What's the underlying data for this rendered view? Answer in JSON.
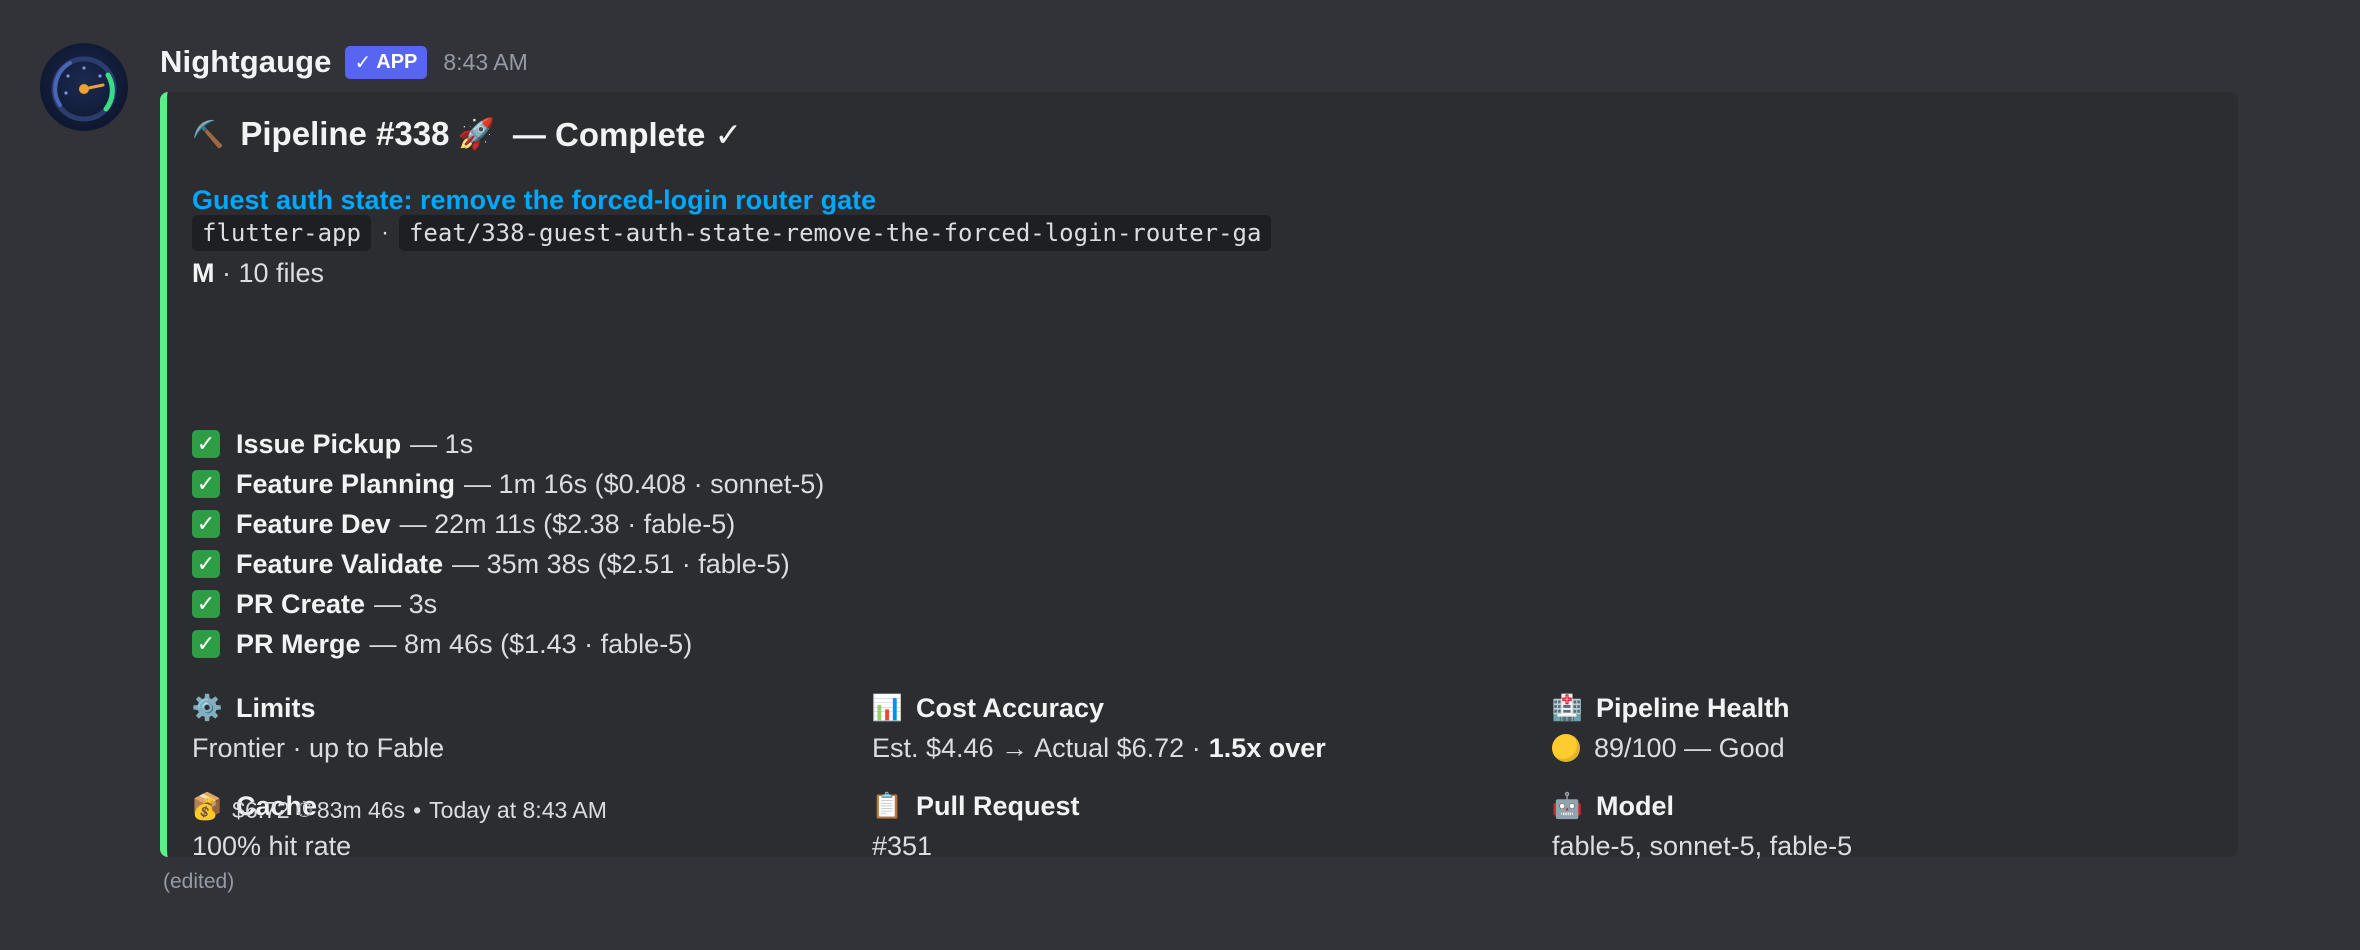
{
  "message": {
    "username": "Nightgauge",
    "badge_check": "✓",
    "badge_label": "APP",
    "timestamp": "8:43 AM",
    "avatar_icon": "speedometer-icon",
    "edited_label": "(edited)"
  },
  "embed": {
    "accent_color": "#57f287",
    "title_icon": "⛏️",
    "title_text": "Pipeline #338",
    "title_rocket": "🚀",
    "title_suffix": "— Complete ✓",
    "issue_link": "Guest auth state: remove the forced-login router gate",
    "repo": "flutter-app",
    "separator": "·",
    "branch": "feat/338-guest-auth-state-remove-the-forced-login-router-ga",
    "size_label": "M",
    "size_files": "· 10 files",
    "stages": [
      {
        "status_icon": "✓",
        "name": "Issue Pickup",
        "detail": "— 1s"
      },
      {
        "status_icon": "✓",
        "name": "Feature Planning",
        "detail": "— 1m 16s ($0.408 · sonnet-5)"
      },
      {
        "status_icon": "✓",
        "name": "Feature Dev",
        "detail": "— 22m 11s ($2.38 · fable-5)"
      },
      {
        "status_icon": "✓",
        "name": "Feature Validate",
        "detail": "— 35m 38s ($2.51 · fable-5)"
      },
      {
        "status_icon": "✓",
        "name": "PR Create",
        "detail": "— 3s"
      },
      {
        "status_icon": "✓",
        "name": "PR Merge",
        "detail": "— 8m 46s ($1.43 · fable-5)"
      }
    ],
    "fields": {
      "limits": {
        "emoji": "⚙️",
        "name": "Limits",
        "value": "Frontier · up to Fable"
      },
      "cost_accuracy": {
        "emoji": "📊",
        "name": "Cost Accuracy",
        "value": "Est. $4.46 → Actual $6.72 ·",
        "value_bold": "1.5x over"
      },
      "pipeline_health": {
        "emoji": "🏥",
        "name": "Pipeline Health",
        "value": "89/100 — Good",
        "status_color": "#ffcc2f"
      },
      "cache": {
        "emoji": "📦",
        "name": "Cache",
        "value": "100% hit rate"
      },
      "pull_request": {
        "emoji": "📋",
        "name": "Pull Request",
        "value": "#351"
      },
      "model": {
        "emoji": "🤖",
        "name": "Model",
        "value": "fable-5, sonnet-5, fable-5"
      }
    },
    "footer": {
      "bag_icon": "💰",
      "cost": "$6.72",
      "timer_icon": "⏱",
      "duration": "83m 46s",
      "bullet": "•",
      "time": "Today at 8:43 AM"
    }
  }
}
